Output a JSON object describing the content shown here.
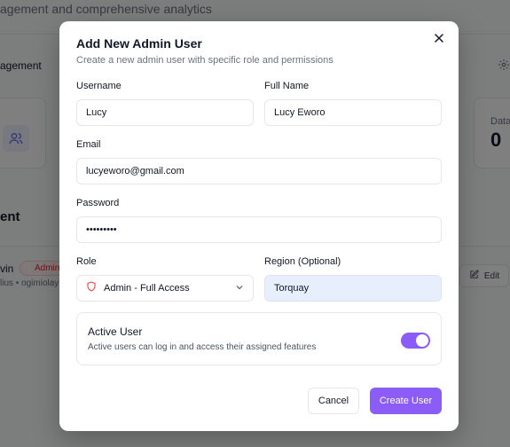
{
  "background": {
    "subtitle": "agement and comprehensive analytics",
    "tab_label": "agement",
    "data_label": "Data",
    "data_value": "0",
    "section_title": "ent",
    "row_name": "vin",
    "row_badge": "Admin",
    "row_sub": "lius • ogimiolay",
    "edit_label": "Edit"
  },
  "modal": {
    "title": "Add New Admin User",
    "description": "Create a new admin user with specific role and permissions",
    "fields": {
      "username": {
        "label": "Username",
        "value": "Lucy"
      },
      "full_name": {
        "label": "Full Name",
        "value": "Lucy Eworo"
      },
      "email": {
        "label": "Email",
        "value": "lucyeworo@gmail.com"
      },
      "password": {
        "label": "Password",
        "value": "Lucy12345"
      },
      "role": {
        "label": "Role",
        "value": "Admin - Full Access"
      },
      "region": {
        "label": "Region (Optional)",
        "value": "Torquay"
      }
    },
    "active_user": {
      "title": "Active User",
      "description": "Active users can log in and access their assigned features",
      "enabled": true
    },
    "buttons": {
      "cancel": "Cancel",
      "create": "Create User"
    }
  },
  "colors": {
    "accent": "#8b5cf6",
    "overlay": "rgba(0,0,0,0.5)",
    "role_icon": "#ef4444",
    "region_highlight": "#e8effc"
  },
  "icons": {
    "close": "close-icon",
    "role": "shield-icon",
    "dropdown": "chevron-down-icon",
    "settings": "gear-icon",
    "users": "users-icon",
    "edit": "edit-icon"
  }
}
